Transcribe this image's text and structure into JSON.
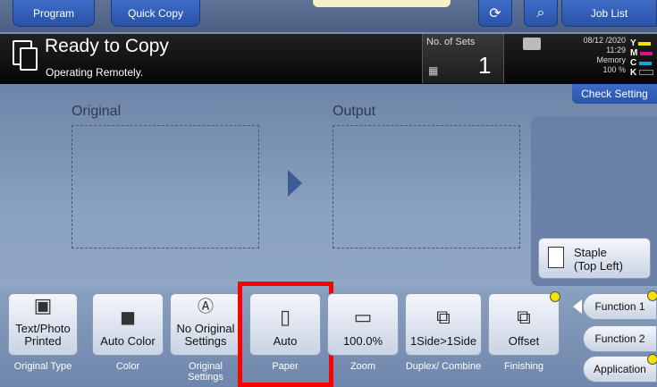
{
  "top_tabs": {
    "program": "Program",
    "quick_copy": "Quick Copy",
    "job_list": "Job List"
  },
  "status": {
    "title": "Ready to Copy",
    "subtitle": "Operating Remotely.",
    "sets_label": "No. of Sets",
    "sets_value": "1",
    "date": "08/12 /2020",
    "time": "11:29",
    "memory_label": "Memory",
    "memory_value": "100 %",
    "toner": [
      "Y",
      "M",
      "C",
      "K"
    ]
  },
  "check_setting": "Check Setting",
  "preview": {
    "original_label": "Original",
    "output_label": "Output"
  },
  "staple": {
    "line1": "Staple",
    "line2": "(Top Left)"
  },
  "settings": [
    {
      "value": "Text/Photo Printed",
      "label": "Original Type"
    },
    {
      "value": "Auto Color",
      "label": "Color"
    },
    {
      "value": "No Original Settings",
      "label": "Original Settings"
    },
    {
      "value": "Auto",
      "label": "Paper"
    },
    {
      "value": "100.0%",
      "label": "Zoom"
    },
    {
      "value": "1Side>1Side",
      "label": "Duplex/ Combine"
    },
    {
      "value": "Offset",
      "label": "Finishing"
    }
  ],
  "side_buttons": {
    "function1": "Function 1",
    "function2": "Function 2",
    "application": "Application"
  },
  "colors": {
    "highlight": "#ff0000",
    "tab_blue": "#2a52a8"
  }
}
